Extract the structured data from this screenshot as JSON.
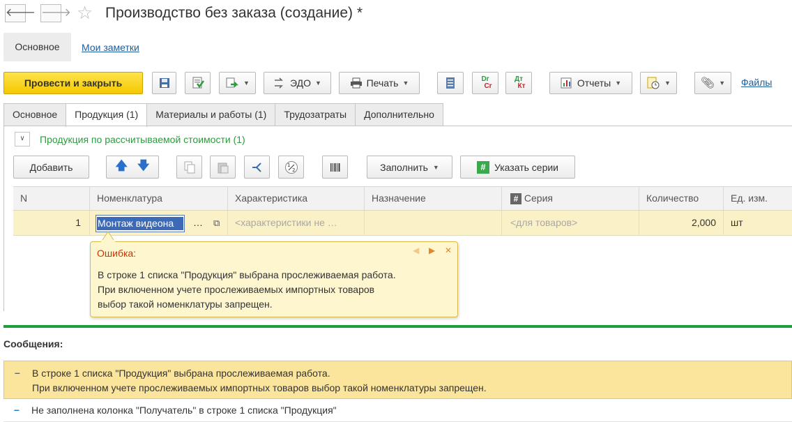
{
  "window": {
    "title": "Производство без заказа (создание) *",
    "back_icon": "arrow-left",
    "forward_icon": "arrow-right",
    "favorite_icon": "star"
  },
  "top_nav": {
    "main_label": "Основное",
    "notes_link": "Мои заметки"
  },
  "toolbar": {
    "post_close": "Провести и закрыть",
    "edo": "ЭДО",
    "print": "Печать",
    "reports": "Отчеты",
    "files": "Файлы",
    "dr_cr_top": "Dr",
    "dr_cr_bottom": "Cr",
    "dt_kt_top": "Дт",
    "dt_kt_bottom": "Кт"
  },
  "tabs": [
    {
      "label": "Основное",
      "active": false
    },
    {
      "label": "Продукция (1)",
      "active": true
    },
    {
      "label": "Материалы и работы (1)",
      "active": false
    },
    {
      "label": "Трудозатраты",
      "active": false
    },
    {
      "label": "Дополнительно",
      "active": false
    }
  ],
  "group": {
    "title": "Продукция по рассчитываемой стоимости (1)"
  },
  "table_toolbar": {
    "add": "Добавить",
    "fill": "Заполнить",
    "series": "Указать серии"
  },
  "table": {
    "columns": [
      "N",
      "Номенклатура",
      "Характеристика",
      "Назначение",
      "Серия",
      "Количество",
      "Ед. изм."
    ],
    "rows": [
      {
        "n": "1",
        "nomenclature": "Монтаж видеона",
        "characteristic": "<характеристики не …",
        "purpose": "",
        "series": "<для товаров>",
        "quantity": "2,000",
        "unit": "шт"
      }
    ]
  },
  "error_popup": {
    "title": "Ошибка:",
    "lines": [
      "В строке 1 списка \"Продукция\" выбрана прослеживаемая работа.",
      "При включенном учете прослеживаемых импортных товаров",
      "выбор такой номенклатуры запрещен."
    ]
  },
  "messages": {
    "title": "Сообщения:",
    "items": [
      {
        "line1": "В строке 1 списка \"Продукция\" выбрана прослеживаемая работа.",
        "line2": "При включенном учете прослеживаемых импортных товаров выбор такой номенклатуры запрещен."
      },
      {
        "line1": "Не заполнена колонка \"Получатель\" в строке 1 списка \"Продукция\""
      }
    ]
  },
  "colors": {
    "accent_yellow": "#f5c800",
    "link_blue": "#1c5c9b",
    "group_green": "#2a9d3c",
    "error_red": "#cc3300",
    "separator_green": "#1aa13c"
  }
}
